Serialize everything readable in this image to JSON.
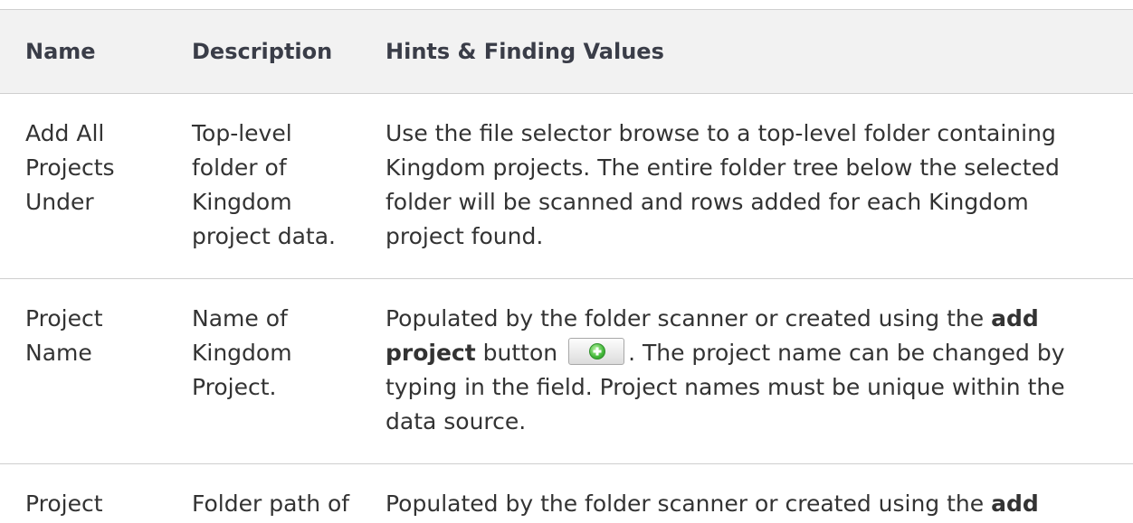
{
  "table": {
    "headers": {
      "name": "Name",
      "description": "Description",
      "hints": "Hints & Finding Values"
    },
    "rows": [
      {
        "name": "Add All Projects Under",
        "description": "Top-level folder of Kingdom project data.",
        "hint": "Use the file selector browse to a top-level folder containing Kingdom projects. The entire folder tree below the selected folder will be scanned and rows added for each Kingdom project found."
      },
      {
        "name": "Project Name",
        "description": "Name of Kingdom Project.",
        "hint_before": "Populated by the folder scanner or created using the ",
        "hint_bold": "add project",
        "hint_mid": " button ",
        "hint_after": ". The project name can be changed by typing in the field. Project names must be unique within the data source.",
        "button_icon": "green-plus-icon"
      },
      {
        "name": "Project",
        "description": "Folder path of",
        "hint_before": "Populated by the folder scanner or created using the ",
        "hint_bold": "add"
      }
    ]
  }
}
